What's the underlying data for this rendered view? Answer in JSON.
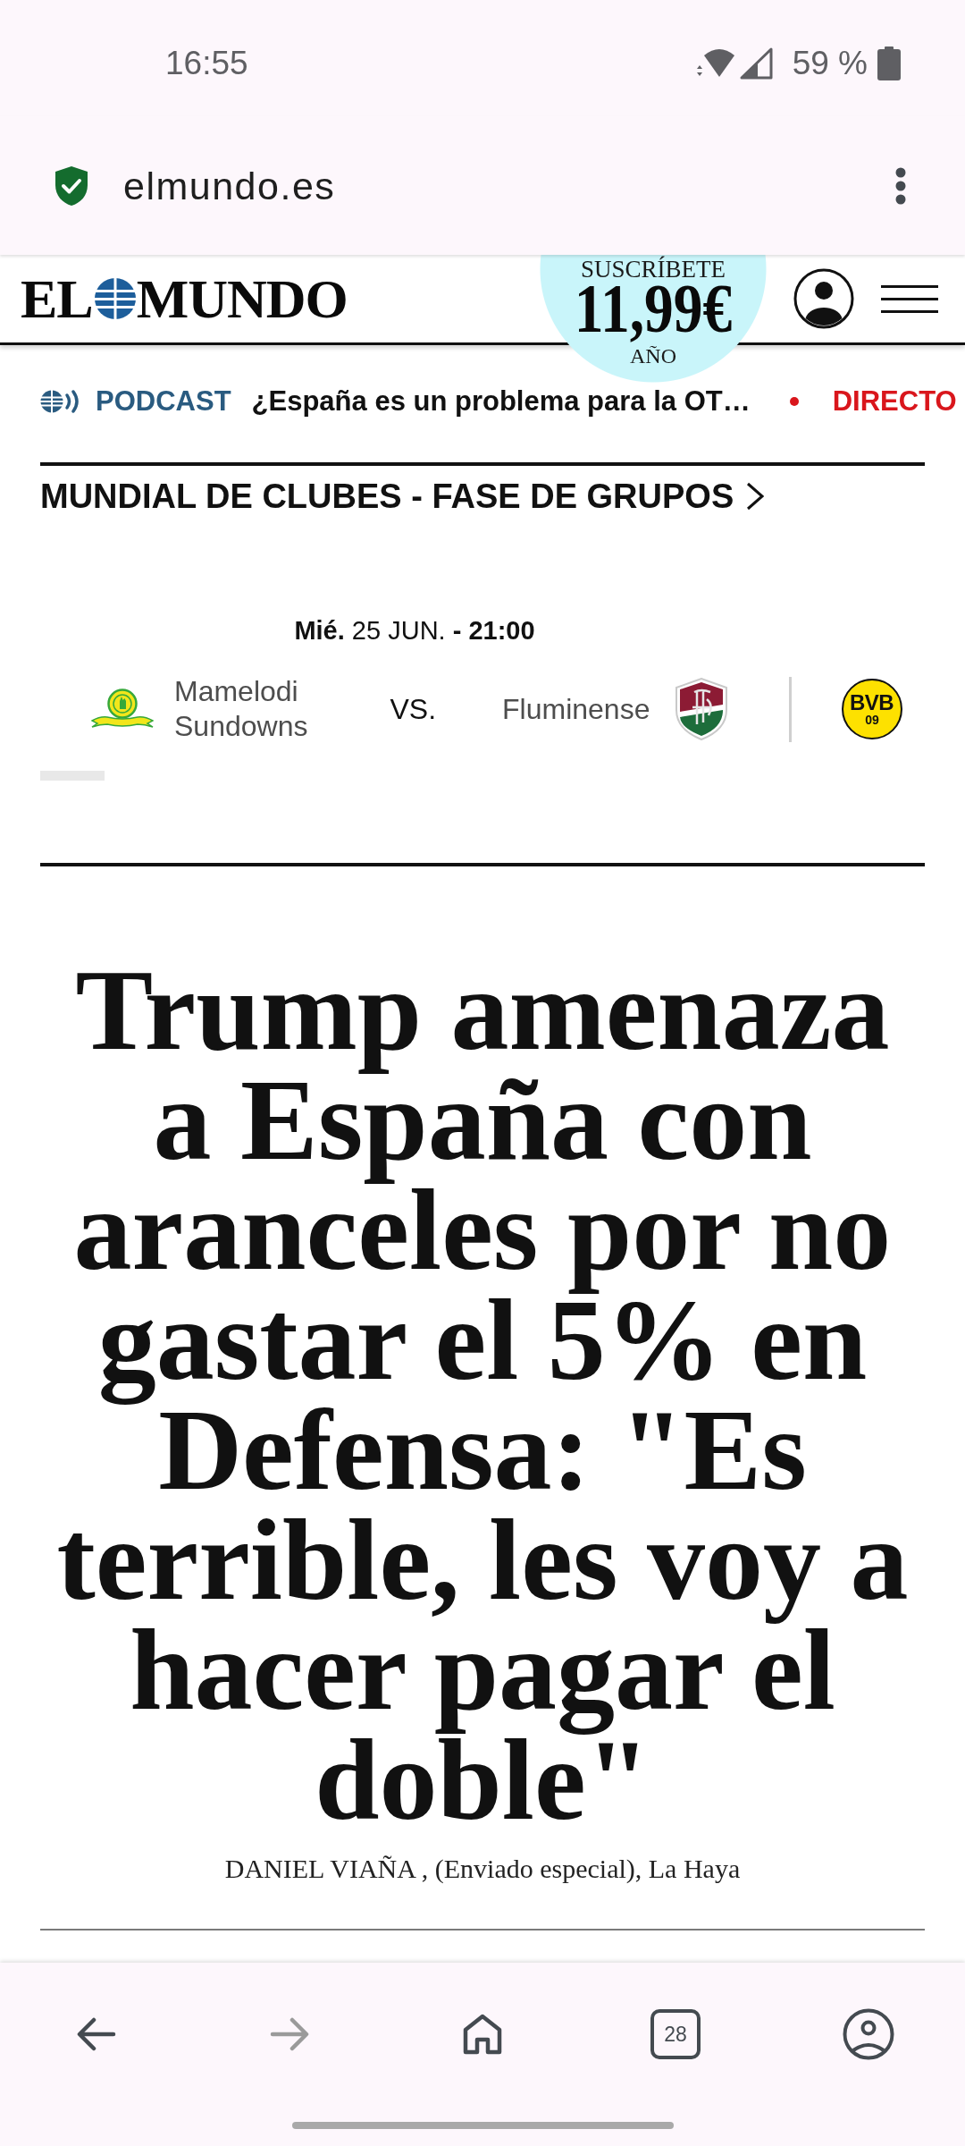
{
  "status_bar": {
    "time": "16:55",
    "battery": "59 %"
  },
  "browser": {
    "url": "elmundo.es"
  },
  "header": {
    "logo": [
      "EL",
      "MUNDO"
    ],
    "subscribe": {
      "label": "SUSCRÍBETE",
      "price": "11,99€",
      "period": "AÑO"
    }
  },
  "ticker": [
    {
      "kind": "podcast",
      "label": "PODCAST",
      "headline": "¿España es un problema para la OT…"
    },
    {
      "kind": "live",
      "label": "DIRECTO"
    }
  ],
  "section": {
    "title": "MUNDIAL DE CLUBES - FASE DE GRUPOS"
  },
  "matches": [
    {
      "date": "**Mié.** 25 JUN. **- 21:00**",
      "versus": "VS.",
      "home": {
        "name": "Mamelodi Sundowns",
        "crest": {
          "kind": "ribbon"
        }
      },
      "away": {
        "name": "Fluminense",
        "crest": {
          "kind": "shield"
        }
      }
    },
    {
      "home": {
        "crest": {
          "kind": "lettered",
          "letters": "BVB",
          "number": "09"
        }
      }
    }
  ],
  "article": {
    "headline": "Trump amenaza a España con aranceles por no gastar el 5% en Defensa: \"Es terrible, les voy a hacer pagar el doble\"",
    "byline": "DANIEL VIAÑA , (Enviado especial), La Haya"
  },
  "nav_bar": [
    {
      "kind": "back",
      "disabled": false
    },
    {
      "kind": "forward",
      "disabled": true
    },
    {
      "kind": "home",
      "disabled": false
    },
    {
      "kind": "tabs",
      "label": "28",
      "disabled": false
    },
    {
      "kind": "account",
      "disabled": false
    }
  ]
}
